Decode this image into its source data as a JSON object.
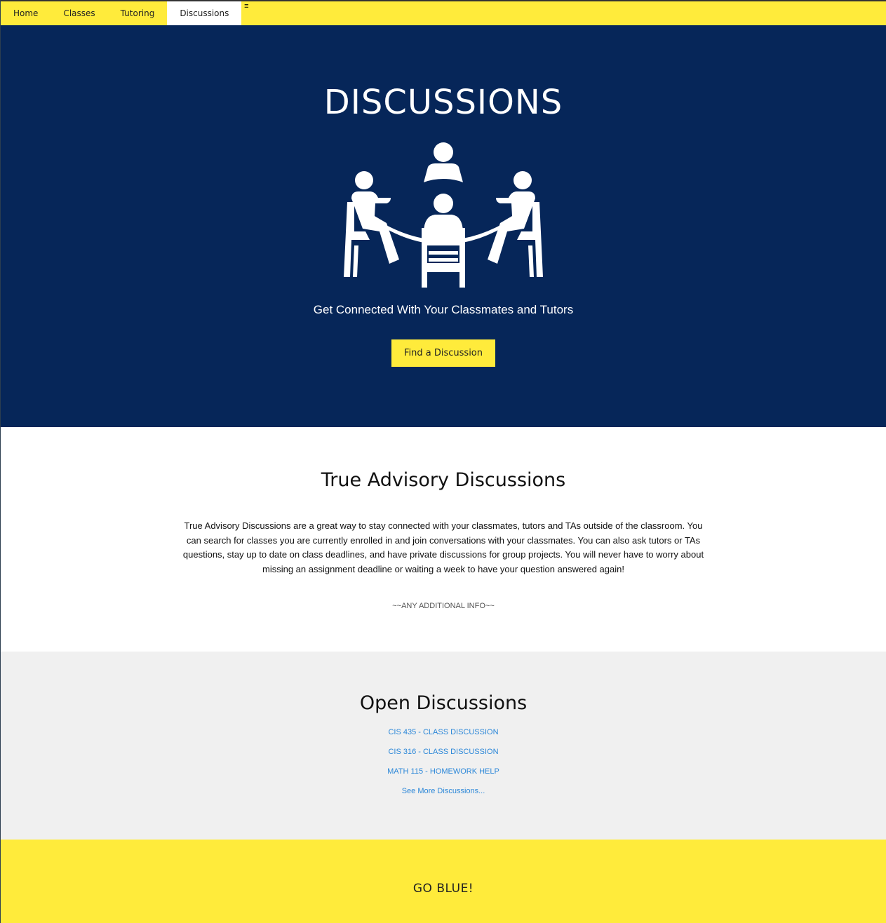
{
  "nav": {
    "items": [
      {
        "label": "Home"
      },
      {
        "label": "Classes"
      },
      {
        "label": "Tutoring"
      },
      {
        "label": "Discussions",
        "active": true
      }
    ],
    "menu_icon": "≡"
  },
  "hero": {
    "title": "DISCUSSIONS",
    "tagline": "Get Connected With Your Classmates and Tutors",
    "cta_label": "Find a Discussion",
    "illustration_icon": "people-around-table-icon"
  },
  "about": {
    "heading": "True Advisory Discussions",
    "body": "True Advisory Discussions are a great way to stay connected with your classmates, tutors and TAs outside of the classroom. You can search for classes you are currently enrolled in and join conversations with your classmates. You can also ask tutors or TAs questions, stay up to date on class deadlines, and have private discussions for group projects. You will never have to worry about missing an assignment deadline or waiting a week to have your question answered again!",
    "extra": "~~ANY ADDITIONAL INFO~~"
  },
  "open": {
    "heading": "Open Discussions",
    "links": [
      {
        "label": "CIS 435 - CLASS DISCUSSION"
      },
      {
        "label": "CIS 316 - CLASS DISCUSSION"
      },
      {
        "label": "MATH 115 - HOMEWORK HELP"
      }
    ],
    "more_label": "See More Discussions..."
  },
  "footer": {
    "text": "GO BLUE!"
  },
  "colors": {
    "accent_yellow": "#ffeb3b",
    "hero_navy": "#062659",
    "link_blue": "#2b87d8"
  }
}
